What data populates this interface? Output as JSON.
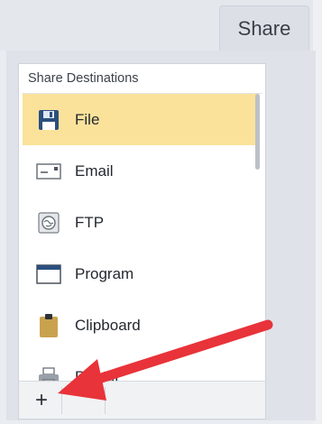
{
  "tab": {
    "label": "Share"
  },
  "panel": {
    "title": "Share Destinations",
    "items": [
      {
        "label": "File",
        "icon": "save-disk-icon",
        "selected": true
      },
      {
        "label": "Email",
        "icon": "email-envelope-icon",
        "selected": false
      },
      {
        "label": "FTP",
        "icon": "ftp-globe-icon",
        "selected": false
      },
      {
        "label": "Program",
        "icon": "program-window-icon",
        "selected": false
      },
      {
        "label": "Clipboard",
        "icon": "clipboard-icon",
        "selected": false
      },
      {
        "label": "Printer",
        "icon": "printer-icon",
        "selected": false
      }
    ]
  },
  "toolbar": {
    "add_label": "+"
  },
  "colors": {
    "selected": "#fbe29b",
    "annotation_arrow": "#e8333a"
  }
}
